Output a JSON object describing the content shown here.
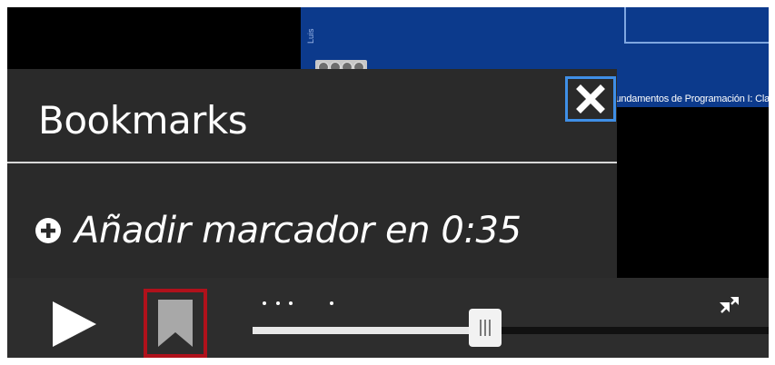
{
  "video": {
    "author_text": "Luis",
    "footer_text": "Fundamentos de Programación I: Clase práct"
  },
  "bookmarks_panel": {
    "title": "Bookmarks",
    "add_bookmark_label": "Añadir marcador en 0:35",
    "close_icon": "close-icon"
  },
  "controls": {
    "play_icon": "play-icon",
    "bookmark_icon": "bookmark-icon",
    "fullscreen_icon": "expand-icon",
    "progress_fraction": 0.45,
    "bookmark_marker_fractions": [
      0.02,
      0.045,
      0.07,
      0.15
    ]
  },
  "colors": {
    "panel_bg": "#2a2a2a",
    "close_focus_border": "#3f8fe6",
    "bookmark_active_border": "#b0111b",
    "slide_bg": "#0c3a8c"
  }
}
